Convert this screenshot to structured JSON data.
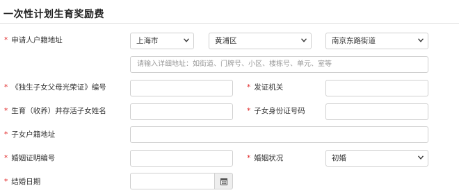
{
  "title": "一次性计划生育奖励费",
  "required_mark": "*",
  "fields": {
    "address": {
      "label": "申请人户籍地址"
    },
    "city_select": {
      "value": "上海市"
    },
    "district_select": {
      "value": "黄浦区"
    },
    "street_select": {
      "value": "南京东路街道"
    },
    "address_detail": {
      "placeholder": "请输入详细地址：如街道、门牌号、小区、楼栋号、单元、室等"
    },
    "certificate_no": {
      "label": "《独生子女父母光荣证》编号"
    },
    "issuing_authority": {
      "label": "发证机关"
    },
    "child_name": {
      "label": "生育（收养）并存活子女姓名"
    },
    "child_id": {
      "label": "子女身份证号码"
    },
    "child_address": {
      "label": "子女户籍地址"
    },
    "marriage_cert": {
      "label": "婚姻证明编号"
    },
    "marital_status": {
      "label": "婚姻状况",
      "value": "初婚"
    },
    "wedding_date": {
      "label": "结婚日期"
    }
  },
  "icons": {
    "caret": "chevron-down-icon",
    "calendar": "calendar-icon"
  }
}
